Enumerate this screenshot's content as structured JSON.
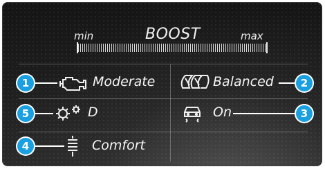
{
  "boost": {
    "title": "BOOST",
    "min_label": "min",
    "max_label": "max",
    "level": 0.0
  },
  "settings": [
    {
      "number": "1",
      "icon": "engine-icon",
      "value": "Moderate"
    },
    {
      "number": "2",
      "icon": "suspension-tyres-icon",
      "value": "Balanced"
    },
    {
      "number": "5",
      "icon": "transmission-gears-icon",
      "value": "D"
    },
    {
      "number": "3",
      "icon": "traction-control-icon",
      "value": "On"
    },
    {
      "number": "4",
      "icon": "steering-spring-icon",
      "value": "Comfort"
    }
  ],
  "colors": {
    "badge": "#1aa0e0",
    "text": "#f0f0f0",
    "background": "#1b1b1b"
  }
}
